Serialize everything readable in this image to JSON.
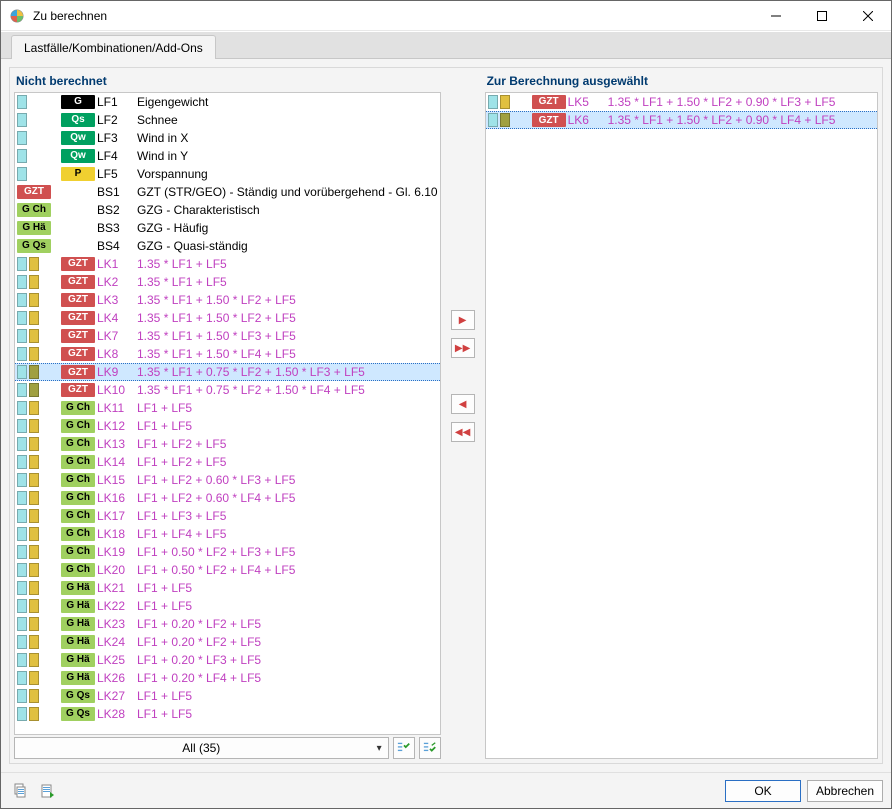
{
  "window": {
    "title": "Zu berechnen"
  },
  "tab": {
    "label": "Lastfälle/Kombinationen/Add-Ons"
  },
  "left": {
    "title": "Nicht berechnet",
    "filter_label": "All (35)",
    "rows": [
      {
        "flags": [
          "cyan"
        ],
        "badge": {
          "bg": "#000000",
          "fg": "#ffffff",
          "text": "G"
        },
        "id": "LF1",
        "desc": "Eigengewicht",
        "kind": "lf"
      },
      {
        "flags": [
          "cyan"
        ],
        "badge": {
          "bg": "#00a060",
          "fg": "#ffffff",
          "text": "Qs"
        },
        "id": "LF2",
        "desc": "Schnee",
        "kind": "lf"
      },
      {
        "flags": [
          "cyan"
        ],
        "badge": {
          "bg": "#00a060",
          "fg": "#ffffff",
          "text": "Qw"
        },
        "id": "LF3",
        "desc": "Wind in X",
        "kind": "lf"
      },
      {
        "flags": [
          "cyan"
        ],
        "badge": {
          "bg": "#00a060",
          "fg": "#ffffff",
          "text": "Qw"
        },
        "id": "LF4",
        "desc": "Wind in Y",
        "kind": "lf"
      },
      {
        "flags": [
          "cyan"
        ],
        "badge": {
          "bg": "#f0d030",
          "fg": "#000000",
          "text": "P"
        },
        "id": "LF5",
        "desc": "Vorspannung",
        "kind": "lf"
      },
      {
        "flags": [],
        "badge": {
          "bg": "#d05050",
          "fg": "#ffffff",
          "text": "GZT"
        },
        "align_badge_left": true,
        "id": "BS1",
        "desc": "GZT (STR/GEO) - Ständig und vorübergehend - Gl. 6.10",
        "kind": "bs"
      },
      {
        "flags": [],
        "badge": {
          "bg": "#a0d060",
          "fg": "#000000",
          "text": "G Ch"
        },
        "align_badge_left": true,
        "id": "BS2",
        "desc": "GZG - Charakteristisch",
        "kind": "bs"
      },
      {
        "flags": [],
        "badge": {
          "bg": "#a0d060",
          "fg": "#000000",
          "text": "G Hä"
        },
        "align_badge_left": true,
        "id": "BS3",
        "desc": "GZG - Häufig",
        "kind": "bs"
      },
      {
        "flags": [],
        "badge": {
          "bg": "#a0d060",
          "fg": "#000000",
          "text": "G Qs"
        },
        "align_badge_left": true,
        "id": "BS4",
        "desc": "GZG - Quasi-ständig",
        "kind": "bs"
      },
      {
        "flags": [
          "cyan",
          "gold"
        ],
        "badge": {
          "bg": "#d05050",
          "fg": "#ffffff",
          "text": "GZT"
        },
        "id": "LK1",
        "desc": "1.35 * LF1 + LF5",
        "kind": "lk"
      },
      {
        "flags": [
          "cyan",
          "gold"
        ],
        "badge": {
          "bg": "#d05050",
          "fg": "#ffffff",
          "text": "GZT"
        },
        "id": "LK2",
        "desc": "1.35 * LF1 + LF5",
        "kind": "lk"
      },
      {
        "flags": [
          "cyan",
          "gold"
        ],
        "badge": {
          "bg": "#d05050",
          "fg": "#ffffff",
          "text": "GZT"
        },
        "id": "LK3",
        "desc": "1.35 * LF1 + 1.50 * LF2 + LF5",
        "kind": "lk"
      },
      {
        "flags": [
          "cyan",
          "gold"
        ],
        "badge": {
          "bg": "#d05050",
          "fg": "#ffffff",
          "text": "GZT"
        },
        "id": "LK4",
        "desc": "1.35 * LF1 + 1.50 * LF2 + LF5",
        "kind": "lk"
      },
      {
        "flags": [
          "cyan",
          "gold"
        ],
        "badge": {
          "bg": "#d05050",
          "fg": "#ffffff",
          "text": "GZT"
        },
        "id": "LK7",
        "desc": "1.35 * LF1 + 1.50 * LF3 + LF5",
        "kind": "lk"
      },
      {
        "flags": [
          "cyan",
          "gold"
        ],
        "badge": {
          "bg": "#d05050",
          "fg": "#ffffff",
          "text": "GZT"
        },
        "id": "LK8",
        "desc": "1.35 * LF1 + 1.50 * LF4 + LF5",
        "kind": "lk"
      },
      {
        "flags": [
          "cyan",
          "olive"
        ],
        "badge": {
          "bg": "#d05050",
          "fg": "#ffffff",
          "text": "GZT"
        },
        "id": "LK9",
        "desc": "1.35 * LF1 + 0.75 * LF2 + 1.50 * LF3 + LF5",
        "kind": "lk",
        "selected": true
      },
      {
        "flags": [
          "cyan",
          "olive"
        ],
        "badge": {
          "bg": "#d05050",
          "fg": "#ffffff",
          "text": "GZT"
        },
        "id": "LK10",
        "desc": "1.35 * LF1 + 0.75 * LF2 + 1.50 * LF4 + LF5",
        "kind": "lk"
      },
      {
        "flags": [
          "cyan",
          "gold"
        ],
        "badge": {
          "bg": "#a0d060",
          "fg": "#000000",
          "text": "G Ch"
        },
        "id": "LK11",
        "desc": "LF1 + LF5",
        "kind": "lk"
      },
      {
        "flags": [
          "cyan",
          "gold"
        ],
        "badge": {
          "bg": "#a0d060",
          "fg": "#000000",
          "text": "G Ch"
        },
        "id": "LK12",
        "desc": "LF1 + LF5",
        "kind": "lk"
      },
      {
        "flags": [
          "cyan",
          "gold"
        ],
        "badge": {
          "bg": "#a0d060",
          "fg": "#000000",
          "text": "G Ch"
        },
        "id": "LK13",
        "desc": "LF1 + LF2 + LF5",
        "kind": "lk"
      },
      {
        "flags": [
          "cyan",
          "gold"
        ],
        "badge": {
          "bg": "#a0d060",
          "fg": "#000000",
          "text": "G Ch"
        },
        "id": "LK14",
        "desc": "LF1 + LF2 + LF5",
        "kind": "lk"
      },
      {
        "flags": [
          "cyan",
          "gold"
        ],
        "badge": {
          "bg": "#a0d060",
          "fg": "#000000",
          "text": "G Ch"
        },
        "id": "LK15",
        "desc": "LF1 + LF2 + 0.60 * LF3 + LF5",
        "kind": "lk"
      },
      {
        "flags": [
          "cyan",
          "gold"
        ],
        "badge": {
          "bg": "#a0d060",
          "fg": "#000000",
          "text": "G Ch"
        },
        "id": "LK16",
        "desc": "LF1 + LF2 + 0.60 * LF4 + LF5",
        "kind": "lk"
      },
      {
        "flags": [
          "cyan",
          "gold"
        ],
        "badge": {
          "bg": "#a0d060",
          "fg": "#000000",
          "text": "G Ch"
        },
        "id": "LK17",
        "desc": "LF1 + LF3 + LF5",
        "kind": "lk"
      },
      {
        "flags": [
          "cyan",
          "gold"
        ],
        "badge": {
          "bg": "#a0d060",
          "fg": "#000000",
          "text": "G Ch"
        },
        "id": "LK18",
        "desc": "LF1 + LF4 + LF5",
        "kind": "lk"
      },
      {
        "flags": [
          "cyan",
          "gold"
        ],
        "badge": {
          "bg": "#a0d060",
          "fg": "#000000",
          "text": "G Ch"
        },
        "id": "LK19",
        "desc": "LF1 + 0.50 * LF2 + LF3 + LF5",
        "kind": "lk"
      },
      {
        "flags": [
          "cyan",
          "gold"
        ],
        "badge": {
          "bg": "#a0d060",
          "fg": "#000000",
          "text": "G Ch"
        },
        "id": "LK20",
        "desc": "LF1 + 0.50 * LF2 + LF4 + LF5",
        "kind": "lk"
      },
      {
        "flags": [
          "cyan",
          "gold"
        ],
        "badge": {
          "bg": "#a0d060",
          "fg": "#000000",
          "text": "G Hä"
        },
        "id": "LK21",
        "desc": "LF1 + LF5",
        "kind": "lk"
      },
      {
        "flags": [
          "cyan",
          "gold"
        ],
        "badge": {
          "bg": "#a0d060",
          "fg": "#000000",
          "text": "G Hä"
        },
        "id": "LK22",
        "desc": "LF1 + LF5",
        "kind": "lk"
      },
      {
        "flags": [
          "cyan",
          "gold"
        ],
        "badge": {
          "bg": "#a0d060",
          "fg": "#000000",
          "text": "G Hä"
        },
        "id": "LK23",
        "desc": "LF1 + 0.20 * LF2 + LF5",
        "kind": "lk"
      },
      {
        "flags": [
          "cyan",
          "gold"
        ],
        "badge": {
          "bg": "#a0d060",
          "fg": "#000000",
          "text": "G Hä"
        },
        "id": "LK24",
        "desc": "LF1 + 0.20 * LF2 + LF5",
        "kind": "lk"
      },
      {
        "flags": [
          "cyan",
          "gold"
        ],
        "badge": {
          "bg": "#a0d060",
          "fg": "#000000",
          "text": "G Hä"
        },
        "id": "LK25",
        "desc": "LF1 + 0.20 * LF3 + LF5",
        "kind": "lk"
      },
      {
        "flags": [
          "cyan",
          "gold"
        ],
        "badge": {
          "bg": "#a0d060",
          "fg": "#000000",
          "text": "G Hä"
        },
        "id": "LK26",
        "desc": "LF1 + 0.20 * LF4 + LF5",
        "kind": "lk"
      },
      {
        "flags": [
          "cyan",
          "gold"
        ],
        "badge": {
          "bg": "#a0d060",
          "fg": "#000000",
          "text": "G Qs"
        },
        "id": "LK27",
        "desc": "LF1 + LF5",
        "kind": "lk"
      },
      {
        "flags": [
          "cyan",
          "gold"
        ],
        "badge": {
          "bg": "#a0d060",
          "fg": "#000000",
          "text": "G Qs"
        },
        "id": "LK28",
        "desc": "LF1 + LF5",
        "kind": "lk"
      }
    ]
  },
  "right": {
    "title": "Zur Berechnung ausgewählt",
    "rows": [
      {
        "flags": [
          "cyan",
          "gold"
        ],
        "badge": {
          "bg": "#d05050",
          "fg": "#ffffff",
          "text": "GZT"
        },
        "id": "LK5",
        "desc": "1.35 * LF1 + 1.50 * LF2 + 0.90 * LF3 + LF5",
        "kind": "lk"
      },
      {
        "flags": [
          "cyan",
          "olive"
        ],
        "badge": {
          "bg": "#d05050",
          "fg": "#ffffff",
          "text": "GZT"
        },
        "id": "LK6",
        "desc": "1.35 * LF1 + 1.50 * LF2 + 0.90 * LF4 + LF5",
        "kind": "lk",
        "selected": true
      }
    ]
  },
  "buttons": {
    "ok": "OK",
    "cancel": "Abbrechen"
  }
}
